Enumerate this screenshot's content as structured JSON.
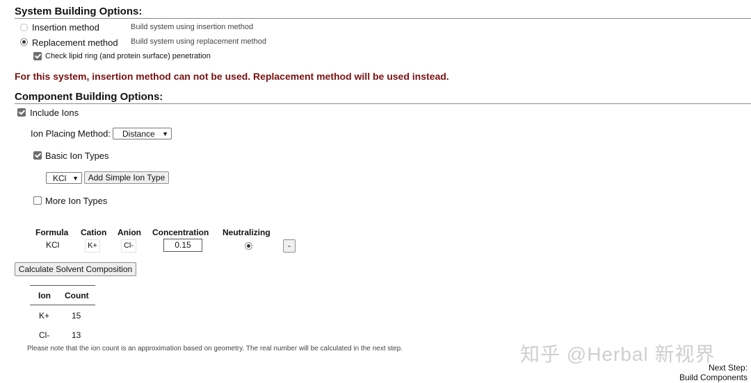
{
  "system_options": {
    "title": "System Building Options:",
    "insertion": {
      "label": "Insertion method",
      "desc": "Build system using insertion method"
    },
    "replacement": {
      "label": "Replacement method",
      "desc": "Build system using replacement method"
    },
    "check_lipid": "Check lipid ring (and protein surface) penetration"
  },
  "warning": "For this system, insertion method can not be used. Replacement method will be used instead.",
  "component_options": {
    "title": "Component Building Options:",
    "include_ions": "Include Ions",
    "ion_placing_label": "Ion Placing Method:",
    "ion_placing_value": "Distance",
    "basic_ion_types": "Basic Ion Types",
    "ion_type_value": "KCl",
    "add_simple_ion_button": "Add Simple Ion Type",
    "more_ion_types": "More Ion Types"
  },
  "ion_table": {
    "headers": [
      "Formula",
      "Cation",
      "Anion",
      "Concentration",
      "Neutralizing"
    ],
    "row": {
      "formula": "KCl",
      "cation": "K+",
      "anion": "Cl-",
      "concentration": "0.15"
    },
    "remove_button": "-"
  },
  "calc_button": "Calculate Solvent Composition",
  "count_table": {
    "headers": [
      "Ion",
      "Count"
    ],
    "rows": [
      {
        "ion": "K+",
        "count": "15"
      },
      {
        "ion": "Cl-",
        "count": "13"
      }
    ]
  },
  "note": "Please note that the ion count is an approximation based on geometry. The real number will be calculated in the next step.",
  "watermark": "知乎 @Herbal 新视界",
  "next_step": {
    "label": "Next Step:",
    "value": "Build Components"
  },
  "icons": {
    "select_chevron": "chevron-down-icon"
  }
}
